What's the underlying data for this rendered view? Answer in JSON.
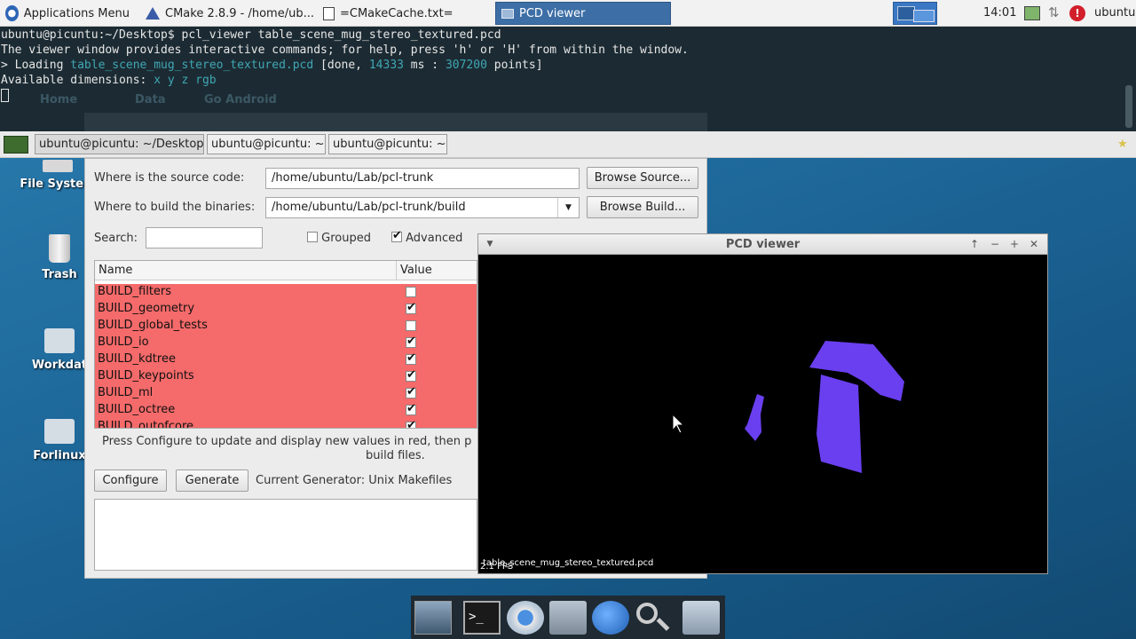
{
  "top_panel": {
    "apps_menu": "Applications Menu",
    "tasks": [
      {
        "label": "CMake 2.8.9 - /home/ub..."
      },
      {
        "label": "=CMakeCache.txt="
      },
      {
        "label": "PCD viewer"
      }
    ],
    "clock": "14:01",
    "user": "ubuntu"
  },
  "terminal": {
    "prompt": "ubuntu@picuntu:~/Desktop$ pcl_viewer table_scene_mug_stereo_textured.pcd",
    "line2": "The viewer window provides interactive commands; for help, press 'h' or 'H' from within the window.",
    "loading_prefix": "> Loading ",
    "loading_file": "table_scene_mug_stereo_textured.pcd",
    "loading_mid": " [done, ",
    "loading_ms": "14333",
    "loading_ms_suffix": " ms : ",
    "loading_points": "307200",
    "loading_end": " points]",
    "dims_prefix": "Available dimensions: ",
    "dims": "x y z rgb",
    "ghost_home": "Home",
    "ghost_data": "Data",
    "ghost_android": "Go Android"
  },
  "term_tabs": [
    {
      "label": "ubuntu@picuntu: ~/Desktop"
    },
    {
      "label": "ubuntu@picuntu: ~"
    },
    {
      "label": "ubuntu@picuntu: ~"
    }
  ],
  "desktop_icons": [
    {
      "label": "File System"
    },
    {
      "label": "Trash"
    },
    {
      "label": "Workdat"
    },
    {
      "label": "Forlinux"
    }
  ],
  "cmake": {
    "source_label": "Where is the source code:",
    "source_value": "/home/ubuntu/Lab/pcl-trunk",
    "browse_source": "Browse Source...",
    "build_label": "Where to build the binaries:",
    "build_value": "/home/ubuntu/Lab/pcl-trunk/build",
    "browse_build": "Browse Build...",
    "search_label": "Search:",
    "grouped": "Grouped",
    "advanced": "Advanced",
    "col_name": "Name",
    "col_value": "Value",
    "rows": [
      {
        "name": "BUILD_filters",
        "checked": false
      },
      {
        "name": "BUILD_geometry",
        "checked": true
      },
      {
        "name": "BUILD_global_tests",
        "checked": false
      },
      {
        "name": "BUILD_io",
        "checked": true
      },
      {
        "name": "BUILD_kdtree",
        "checked": true
      },
      {
        "name": "BUILD_keypoints",
        "checked": true
      },
      {
        "name": "BUILD_ml",
        "checked": true
      },
      {
        "name": "BUILD_octree",
        "checked": true
      },
      {
        "name": "BUILD_outofcore",
        "checked": true
      }
    ],
    "hint_line1": "Press Configure to update and display new values in red, then p",
    "hint_line2": "build files.",
    "configure": "Configure",
    "generate": "Generate",
    "generator": "Current Generator: Unix Makefiles"
  },
  "pcd_viewer": {
    "title": "PCD viewer",
    "filename": "table_scene_mug_stereo_textured.pcd",
    "fps": "2.1 FPS",
    "point_color": "#6a3ff0"
  }
}
